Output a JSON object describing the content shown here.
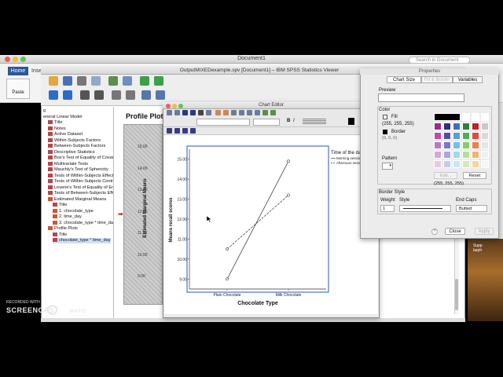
{
  "word": {
    "title": "Document1",
    "tabs": [
      "Home",
      "Insert"
    ],
    "paste_label": "Paste",
    "search_placeholder": "Search in Document"
  },
  "spss": {
    "title": "OutputMIXEDexample.spv [Document1] – IBM SPSS Statistics Viewer",
    "outline": [
      {
        "label": "g",
        "indent": 0,
        "kind": "log"
      },
      {
        "label": "eneral Linear Model",
        "indent": 0,
        "kind": "book"
      },
      {
        "label": "Title",
        "indent": 1,
        "kind": "item"
      },
      {
        "label": "Notes",
        "indent": 1,
        "kind": "item"
      },
      {
        "label": "Active Dataset",
        "indent": 1,
        "kind": "item"
      },
      {
        "label": "Within-Subjects Factors",
        "indent": 1,
        "kind": "item"
      },
      {
        "label": "Between-Subjects Factors",
        "indent": 1,
        "kind": "item"
      },
      {
        "label": "Descriptive Statistics",
        "indent": 1,
        "kind": "item"
      },
      {
        "label": "Box's Test of Equality of Covari",
        "indent": 1,
        "kind": "item"
      },
      {
        "label": "Multivariate Tests",
        "indent": 1,
        "kind": "item"
      },
      {
        "label": "Mauchly's Test of Sphericity",
        "indent": 1,
        "kind": "item"
      },
      {
        "label": "Tests of Within-Subjects Effects",
        "indent": 1,
        "kind": "item"
      },
      {
        "label": "Tests of Within-Subjects Contra",
        "indent": 1,
        "kind": "item"
      },
      {
        "label": "Levene's Test of Equality of Err",
        "indent": 1,
        "kind": "item"
      },
      {
        "label": "Tests of Between-Subjects Effe",
        "indent": 1,
        "kind": "item"
      },
      {
        "label": "Estimated Marginal Means",
        "indent": 1,
        "kind": "book"
      },
      {
        "label": "Title",
        "indent": 2,
        "kind": "item"
      },
      {
        "label": "1. chocolate_type",
        "indent": 2,
        "kind": "book"
      },
      {
        "label": "2. time_day",
        "indent": 2,
        "kind": "book"
      },
      {
        "label": "3. chocolate_type * time_day",
        "indent": 2,
        "kind": "book"
      },
      {
        "label": "Profile Plots",
        "indent": 1,
        "kind": "book"
      },
      {
        "label": "Title",
        "indent": 2,
        "kind": "item"
      },
      {
        "label": "chocolate_type * time_day",
        "indent": 2,
        "kind": "item",
        "selected": true
      }
    ],
    "profile_heading": "Profile Plots",
    "background_ylabel": "Estimated Marginal Means",
    "background_ticks": [
      "15.00",
      "14.00",
      "13.00",
      "12.00",
      "11.00",
      "10.00",
      "9.00"
    ]
  },
  "chart_editor": {
    "title": "Chart Editor"
  },
  "chart_data": {
    "type": "line",
    "categories": [
      "Plain Chocolate",
      "Milk Chocolate"
    ],
    "series": [
      {
        "name": "Morning session",
        "values": [
          9.0,
          14.9
        ],
        "style": "solid"
      },
      {
        "name": "Afternoon session",
        "values": [
          10.5,
          13.2
        ],
        "style": "dashed"
      }
    ],
    "xlabel": "Chocolate Type",
    "ylabel": "Means recall scores",
    "ylim": [
      8.5,
      15.5
    ],
    "yticks": [
      "15.00",
      "14.00",
      "13.00",
      "12.00",
      "11.00",
      "10.00",
      "9.00"
    ],
    "legend_title": "Time of the da",
    "legend_placement": "right",
    "grid": false
  },
  "properties": {
    "title": "Properties",
    "tabs": [
      "Chart Size",
      "Fill & Border",
      "Variables"
    ],
    "preview_label": "Preview",
    "color_label": "Color",
    "fill_label": "Fill",
    "fill_rgb": "(255, 255, 255)",
    "border_label": "Border",
    "border_rgb": "(0, 0, 0)",
    "pattern_label": "Pattern",
    "edit_label": "Edit...",
    "reset_label": "Reset",
    "selected_rgb": "(255, 255, 255)",
    "border_style_label": "Border Style",
    "weight_label": "Weight",
    "weight_value": "1",
    "style_label": "Style",
    "end_caps_label": "End Caps",
    "end_caps_value": "Butted",
    "close_label": "Close",
    "apply_label": "Apply",
    "help_label": "?",
    "palette": [
      "#000000",
      "#ffffff",
      "#ffffff",
      "#ffffff",
      "#ffffff",
      "#ffffff",
      "#9c2b8e",
      "#2f2f7a",
      "#3b6ec0",
      "#2e7f3b",
      "#c21f2b",
      "#c9c9c9",
      "#c24aa5",
      "#4f4fa8",
      "#52a0d8",
      "#4caf50",
      "#e8483a",
      "#d9d9d9",
      "#b87ac0",
      "#7a78c8",
      "#6cc2e8",
      "#8bcb69",
      "#f07f4b",
      "#e6e6e6",
      "#d6a8d8",
      "#a8a6df",
      "#9fd8f0",
      "#b8dc96",
      "#f7b36a",
      "#f0f0f0",
      "#e6c9e8",
      "#c9c8ec",
      "#c8e8f6",
      "#d4eabd",
      "#f9d59a",
      "#f7f7f7"
    ]
  },
  "watermark": {
    "line1": "RECORDED WITH",
    "line2": "SCREENCAST",
    "line3": "MATIC"
  },
  "doc_right_text": "Supp\nlarph"
}
